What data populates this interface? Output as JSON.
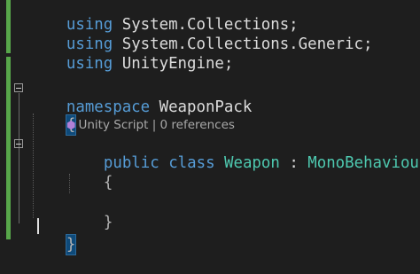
{
  "editor": {
    "lines": {
      "l1_kw": "using",
      "l1_rest": " System.Collections;",
      "l2_kw": "using",
      "l2_rest": " System.Collections.Generic;",
      "l3_kw": "using",
      "l3_rest": " UnityEngine;",
      "l5_kw": "namespace",
      "l5_name": " WeaponPack",
      "l6_brace": "{",
      "l8_public": "public",
      "l8_class": " class",
      "l8_name": " Weapon",
      "l8_colon": " : ",
      "l8_base": "MonoBehaviour",
      "l9_brace": "{",
      "l11_brace": "}",
      "l12_brace": "}"
    },
    "codelens": {
      "icon": "unity-script-icon",
      "text": "Unity Script | 0 references"
    }
  },
  "colors": {
    "background": "#1e1e1e",
    "keyword": "#569cd6",
    "type": "#4ec9b0",
    "text": "#dcdcdc",
    "change_bar": "#57a64a",
    "brace_highlight": "#0e4a7a"
  }
}
